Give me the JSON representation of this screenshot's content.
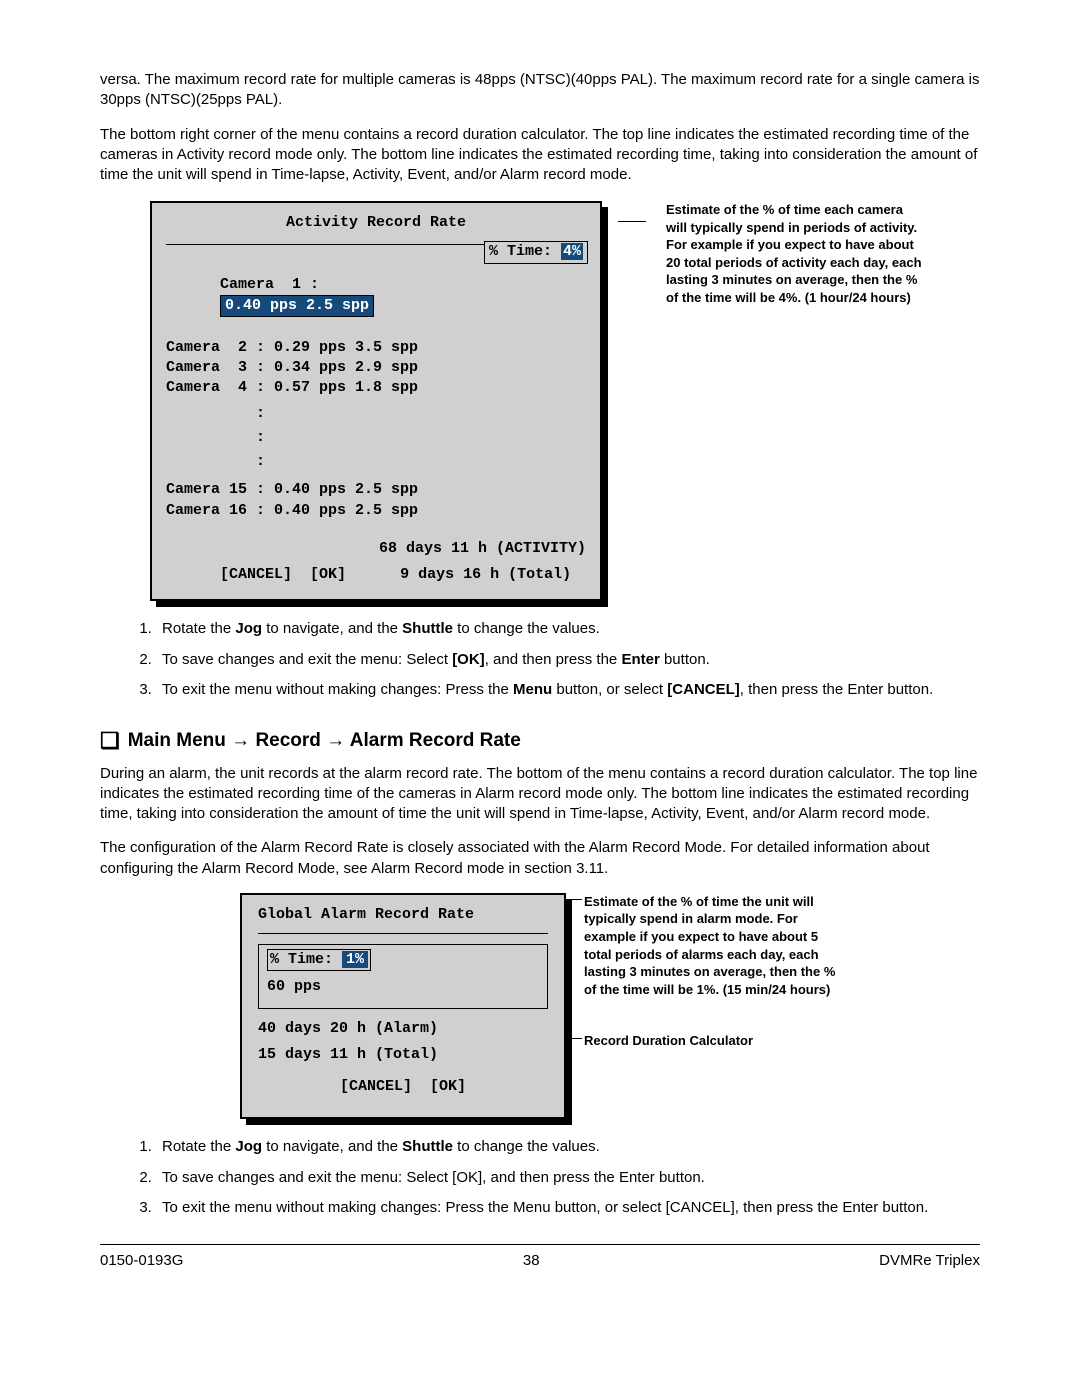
{
  "intro": {
    "p1": "versa.  The maximum record rate for multiple cameras is 48pps (NTSC)(40pps PAL).  The maximum record rate for a single camera is 30pps (NTSC)(25pps PAL).",
    "p2": "The bottom right corner of the menu contains a record duration calculator.  The top line indicates the estimated recording time of the cameras in Activity record mode only.  The bottom line indicates the estimated recording time, taking into consideration the amount of time the unit will spend in Time-lapse, Activity, Event, and/or Alarm record mode."
  },
  "activity_menu": {
    "title": "Activity Record Rate",
    "rows": [
      "Camera  1 :",
      "Camera  2 : 0.29 pps 3.5 spp",
      "Camera  3 : 0.34 pps 2.9 spp",
      "Camera  4 : 0.57 pps 1.8 spp"
    ],
    "row1_sel": "0.40 pps 2.5 spp",
    "empties": "          :\n          :\n          :",
    "rows_tail": [
      "Camera 15 : 0.40 pps 2.5 spp",
      "Camera 16 : 0.40 pps 2.5 spp"
    ],
    "time_label": "% Time:",
    "time_value": "4%",
    "footer_activity": "68 days 11 h (ACTIVITY)",
    "btn_cancel": "[CANCEL]",
    "btn_ok": "[OK]",
    "footer_total": "9 days 16 h (Total)"
  },
  "callout1": "Estimate of the % of time each camera will typically spend in periods of activity. For example if you expect to have about 20 total periods of activity each day, each lasting 3 minutes on average, then the % of the time will be 4%. (1 hour/24 hours)",
  "steps1": {
    "s1a": "Rotate the ",
    "s1b": "Jog",
    "s1c": " to navigate, and the ",
    "s1d": "Shuttle",
    "s1e": " to change the values.",
    "s2a": "To save changes and exit the menu:  Select ",
    "s2b": "[OK]",
    "s2c": ", and then press the ",
    "s2d": "Enter",
    "s2e": " button.",
    "s3a": "To exit the menu without making changes:  Press the ",
    "s3b": "Menu",
    "s3c": " button, or select ",
    "s3d": "[CANCEL]",
    "s3e": ", then press the Enter button."
  },
  "section_heading": "Main Menu → Record → Alarm Record Rate",
  "alarm_intro": {
    "p1": "During an alarm, the unit records at the alarm record rate. The bottom of the menu contains a record duration calculator.  The top line indicates the estimated recording time of the cameras in Alarm record mode only. The bottom line indicates the estimated recording time, taking into consideration the amount of time the unit will spend in Time-lapse, Activity, Event, and/or Alarm record mode.",
    "p2": "The configuration of the Alarm Record Rate is closely associated with the Alarm Record Mode.  For detailed information about configuring the Alarm Record Mode, see Alarm Record mode in section 3.11."
  },
  "alarm_menu": {
    "title": "Global Alarm Record Rate",
    "time_label": "% Time:",
    "time_value": "1%",
    "pps": "60 pps",
    "dur1": "40 days 20 h (Alarm)",
    "dur2": "15 days 11 h (Total)",
    "btn_cancel": "[CANCEL]",
    "btn_ok": "[OK]"
  },
  "callout2a": "Estimate of the % of time the unit will typically spend in alarm mode. For example if you expect to have about 5 total periods of alarms each day, each lasting 3 minutes on average, then the % of the time will be 1%. (15 min/24 hours)",
  "callout2b": "Record Duration Calculator",
  "steps2": {
    "s1a": "Rotate the ",
    "s1b": "Jog",
    "s1c": " to navigate, and the ",
    "s1d": "Shuttle",
    "s1e": " to change the values.",
    "s2": "To save changes and exit the menu:  Select [OK], and then press the Enter button.",
    "s3": "To exit the menu without making changes:  Press the Menu button, or select [CANCEL], then press the Enter button."
  },
  "footer": {
    "left": "0150-0193G",
    "center": "38",
    "right": "DVMRe Triplex"
  }
}
